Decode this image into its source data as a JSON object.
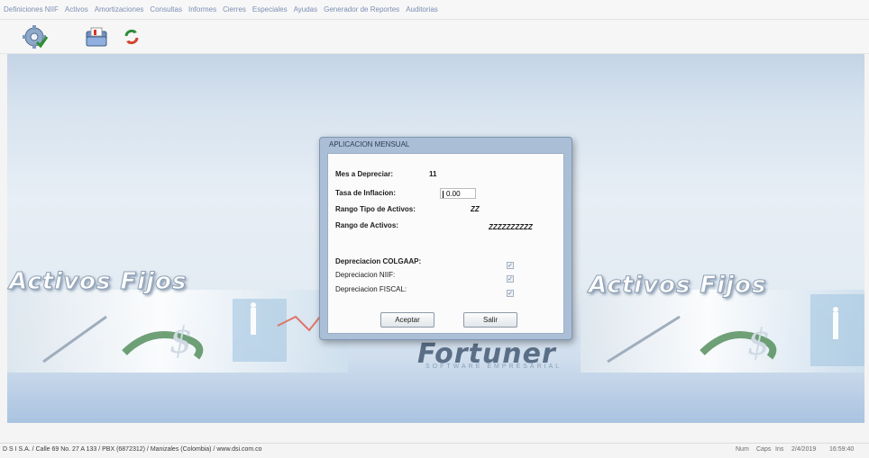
{
  "menu": {
    "items": [
      "Definiciones NIIF",
      "Activos",
      "Amortizaciones",
      "Consultas",
      "Informes",
      "Cierres",
      "Especiales",
      "Ayudas",
      "Generador de Reportes",
      "Auditorias"
    ]
  },
  "toolbar": {
    "icons": [
      "settings-icon",
      "folder-icon",
      "refresh-icon"
    ]
  },
  "banner": {
    "left_title": "Activos Fijos",
    "right_title": "Activos Fijos",
    "brand": "Fortuner",
    "brand_sub": "SOFTWARE EMPRESARIAL"
  },
  "dialog": {
    "title": "APLICACION MENSUAL",
    "mes_label": "Mes a Depreciar:",
    "mes_value": "11",
    "tasa_label": "Tasa de Inflacion:",
    "tasa_value": "0.00",
    "rango_tipo_label": "Rango Tipo de Activos:",
    "rango_tipo_value": "ZZ",
    "rango_activos_label": "Rango de Activos:",
    "rango_activos_value": "ZZZZZZZZZZ",
    "dep_colgaap_label": "Depreciacion COLGAAP:",
    "dep_niif_label": "Depreciacion NIIF:",
    "dep_fiscal_label": "Depreciacion FISCAL:",
    "checkbox_mark": "✓",
    "accept_label": "Aceptar",
    "exit_label": "Salir"
  },
  "status": {
    "left": "D S I S.A. / Calle 69 No. 27 A 133 / PBX (6872312) / Manizales (Colombia) / www.dsi.com.co",
    "num": "Num",
    "caps": "Caps",
    "ins": "Ins",
    "date": "2/4/2019",
    "time": "16:59:40"
  }
}
